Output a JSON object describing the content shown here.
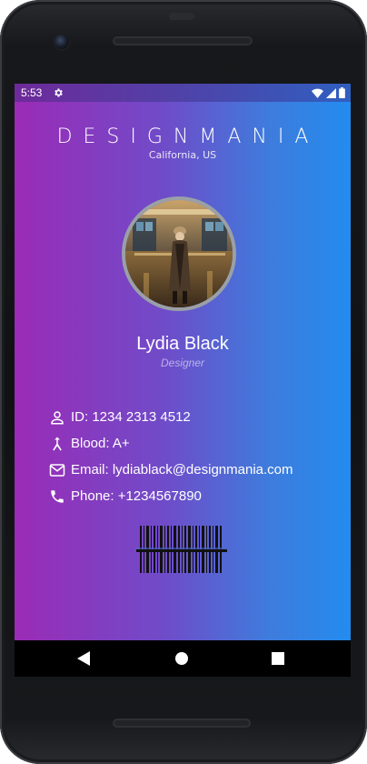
{
  "status_bar": {
    "time": "5:53"
  },
  "card": {
    "brand": "DESIGNMANIA",
    "location": "California, US",
    "name": "Lydia Black",
    "role": "Designer",
    "details": [
      {
        "icon": "person-icon",
        "text": "ID: 1234 2313 4512"
      },
      {
        "icon": "blood-icon",
        "text": "Blood: A+"
      },
      {
        "icon": "email-icon",
        "text": "Email: lydiablack@designmania.com"
      },
      {
        "icon": "phone-icon",
        "text": "Phone: +1234567890"
      }
    ]
  },
  "nav": {
    "buttons": [
      "back-button",
      "home-button",
      "recents-button"
    ]
  },
  "colors": {
    "gradient_start": "#9b2bb6",
    "gradient_end": "#238cef",
    "avatar_border": "#9aa0a6"
  }
}
